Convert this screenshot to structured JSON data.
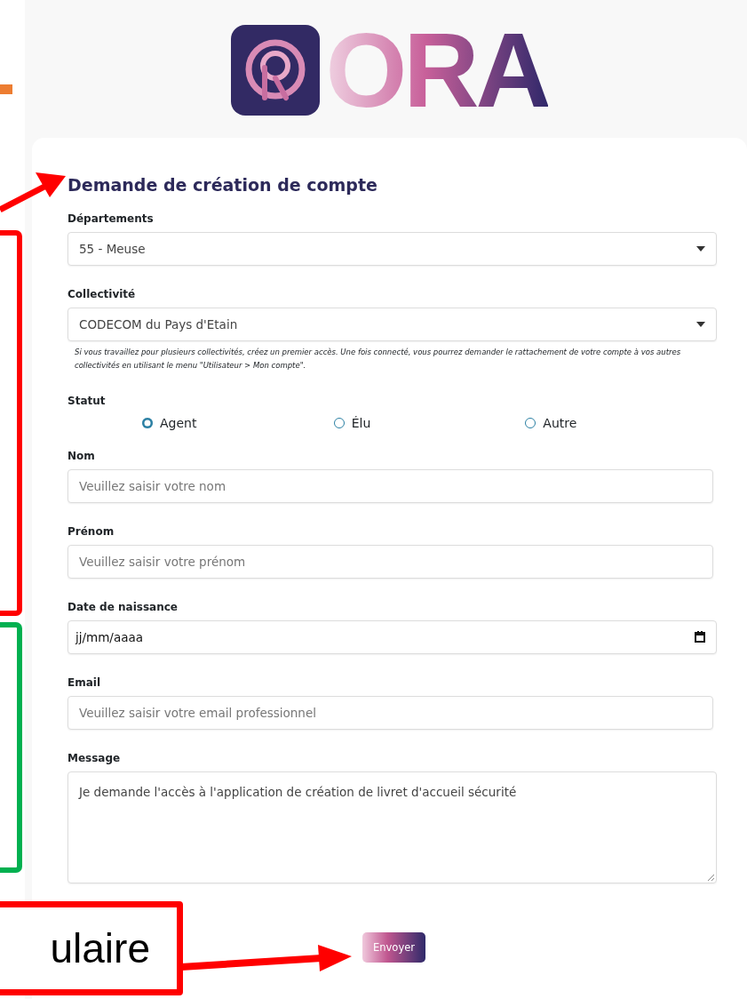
{
  "logo": {
    "text": "ORA"
  },
  "form": {
    "title": "Demande de création de compte",
    "fields": [
      {
        "kind": "select",
        "label": "Départements",
        "value": "55 - Meuse"
      },
      {
        "kind": "select",
        "label": "Collectivité",
        "value": "CODECOM du Pays d'Etain",
        "help": "Si vous travaillez pour plusieurs collectivités, créez un premier accès. Une fois connecté, vous pourrez demander le rattachement de votre compte à vos autres collectivités en utilisant le menu \"Utilisateur > Mon compte\"."
      },
      {
        "kind": "radio",
        "label": "Statut",
        "options": [
          {
            "label": "Agent",
            "selected": true
          },
          {
            "label": "Élu",
            "selected": false
          },
          {
            "label": "Autre",
            "selected": false
          }
        ]
      },
      {
        "kind": "text",
        "label": "Nom",
        "placeholder": "Veuillez saisir votre nom"
      },
      {
        "kind": "text",
        "label": "Prénom",
        "placeholder": "Veuillez saisir votre prénom"
      },
      {
        "kind": "date",
        "label": "Date de naissance",
        "value": "jj/mm/aaaa"
      },
      {
        "kind": "text",
        "label": "Email",
        "placeholder": "Veuillez saisir votre email professionnel"
      },
      {
        "kind": "textarea",
        "label": "Message",
        "value": "Je demande l'accès à l'application de création de livret d'accueil sécurité"
      }
    ],
    "submit": "Envoyer"
  },
  "annotations": {
    "callout_text": "ulaire"
  }
}
